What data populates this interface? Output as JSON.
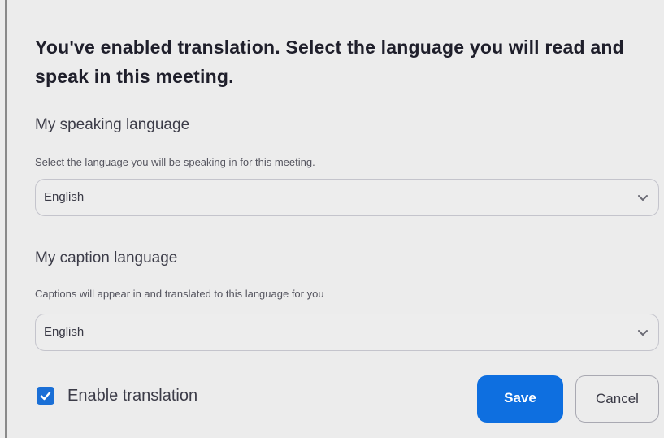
{
  "dialog": {
    "title": "You've enabled translation. Select the language you will read and speak in this meeting."
  },
  "speaking": {
    "label": "My speaking language",
    "description": "Select the language you will be speaking in for this meeting.",
    "selected": "English",
    "icon": "chevron-down-icon"
  },
  "caption": {
    "label": "My caption language",
    "description": "Captions will appear in and translated to this language for you",
    "selected": "English",
    "icon": "chevron-down-icon"
  },
  "footer": {
    "enable_label": "Enable translation",
    "enable_checked": true,
    "save_label": "Save",
    "cancel_label": "Cancel"
  },
  "colors": {
    "accent": "#0e6fe0",
    "background": "#ececec",
    "border": "#c4c4cc"
  }
}
